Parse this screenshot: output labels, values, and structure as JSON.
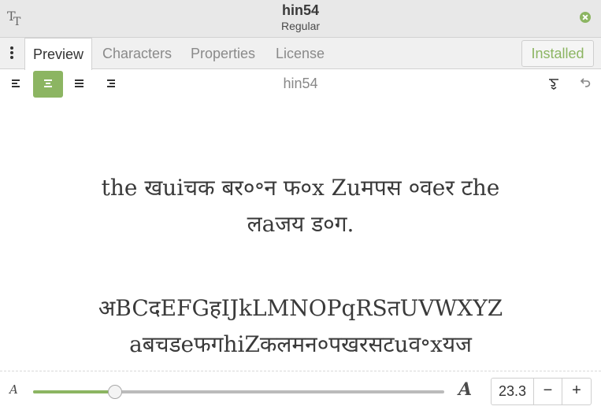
{
  "window": {
    "title": "hin54",
    "subtitle": "Regular",
    "app_icon": "font-icon",
    "close_icon": "close-icon"
  },
  "tabs": [
    {
      "label": "Preview",
      "active": true
    },
    {
      "label": "Characters",
      "active": false
    },
    {
      "label": "Properties",
      "active": false
    },
    {
      "label": "License",
      "active": false
    }
  ],
  "menu_icon": "vertical-dots-icon",
  "installed_label": "Installed",
  "toolbar": {
    "preview_label": "hin54",
    "alignment_buttons": [
      "align-left",
      "align-center",
      "align-justify",
      "align-right"
    ],
    "active_alignment": "align-center",
    "right_icons": [
      "glyph-style-icon",
      "undo-icon"
    ]
  },
  "preview": {
    "line1": "the खuiचक बर०॰न फ०x Zuमपस ०वeर टhe",
    "line2": "लaजय ड०ग.",
    "line3": "अBCदEFGहIJkLMNOPqRSतUVWXYZ",
    "line4": "aबचडeफगhiZकलमन०पखरसटuव॰xयज"
  },
  "size_control": {
    "value": "23.3",
    "minus_label": "−",
    "plus_label": "+",
    "slider_fraction": 0.2,
    "small_glyph": "A",
    "large_glyph": "A"
  },
  "colors": {
    "accent": "#8cb562"
  }
}
